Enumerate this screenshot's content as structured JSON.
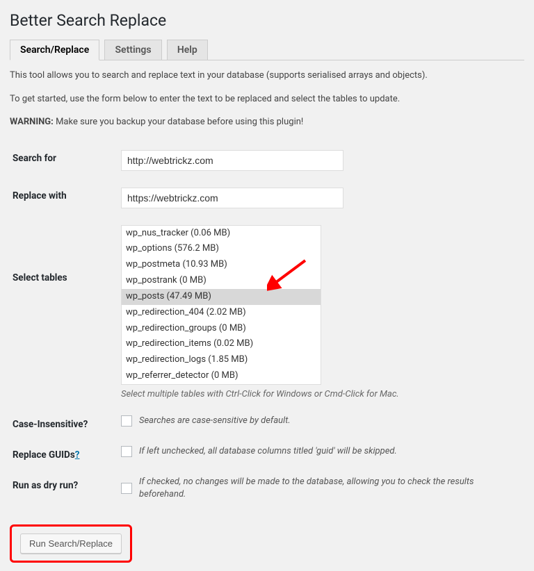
{
  "page_title": "Better Search Replace",
  "tabs": [
    {
      "label": "Search/Replace",
      "active": true
    },
    {
      "label": "Settings",
      "active": false
    },
    {
      "label": "Help",
      "active": false
    }
  ],
  "intro": {
    "line1": "This tool allows you to search and replace text in your database (supports serialised arrays and objects).",
    "line2": "To get started, use the form below to enter the text to be replaced and select the tables to update.",
    "warning_label": "WARNING:",
    "warning_text": " Make sure you backup your database before using this plugin!"
  },
  "fields": {
    "search_for": {
      "label": "Search for",
      "value": "http://webtrickz.com"
    },
    "replace_with": {
      "label": "Replace with",
      "value": "https://webtrickz.com"
    },
    "select_tables": {
      "label": "Select tables",
      "options": [
        {
          "text": "wp_nus_tracker (0.06 MB)",
          "selected": false
        },
        {
          "text": "wp_options (576.2 MB)",
          "selected": false
        },
        {
          "text": "wp_postmeta (10.93 MB)",
          "selected": false
        },
        {
          "text": "wp_postrank (0 MB)",
          "selected": false
        },
        {
          "text": "wp_posts (47.49 MB)",
          "selected": true
        },
        {
          "text": "wp_redirection_404 (2.02 MB)",
          "selected": false
        },
        {
          "text": "wp_redirection_groups (0 MB)",
          "selected": false
        },
        {
          "text": "wp_redirection_items (0.02 MB)",
          "selected": false
        },
        {
          "text": "wp_redirection_logs (1.85 MB)",
          "selected": false
        },
        {
          "text": "wp_referrer_detector (0 MB)",
          "selected": false
        }
      ],
      "help": "Select multiple tables with Ctrl-Click for Windows or Cmd-Click for Mac."
    },
    "case_insensitive": {
      "label": "Case-Insensitive?",
      "note": "Searches are case-sensitive by default."
    },
    "replace_guids": {
      "label": "Replace GUIDs",
      "question": "?",
      "note": "If left unchecked, all database columns titled 'guid' will be skipped."
    },
    "dry_run": {
      "label": "Run as dry run?",
      "note": "If checked, no changes will be made to the database, allowing you to check the results beforehand."
    }
  },
  "submit_label": "Run Search/Replace"
}
